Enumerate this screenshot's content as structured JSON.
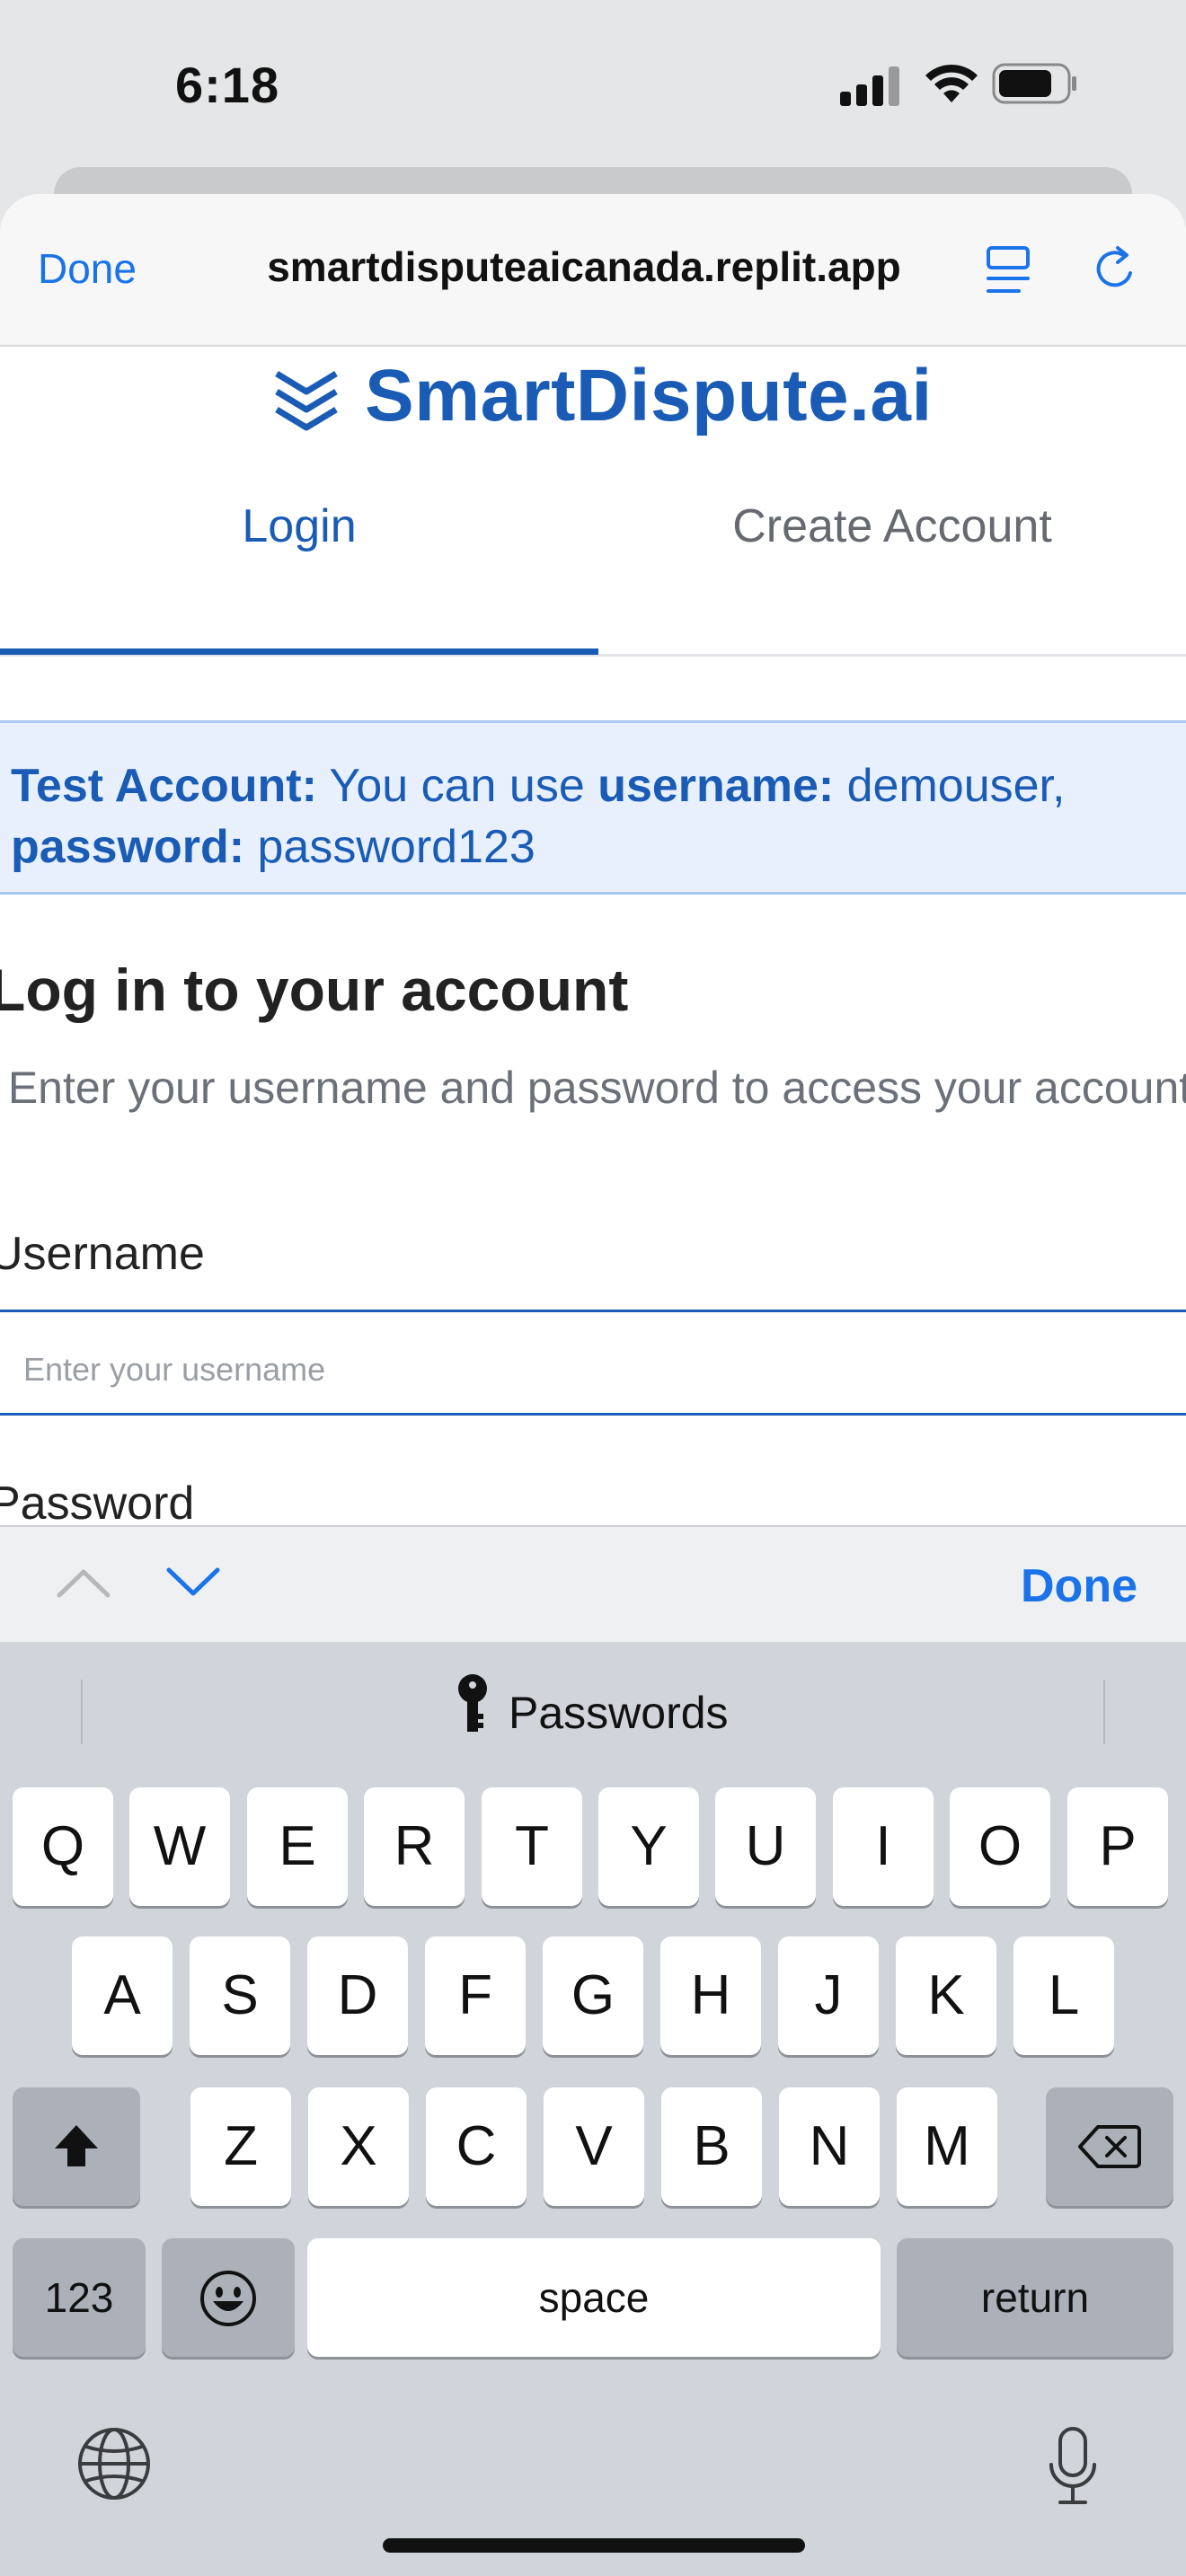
{
  "status_bar": {
    "time": "6:18"
  },
  "browser": {
    "done_label": "Done",
    "url": "smartdisputeaicanada.replit.app",
    "icons": [
      "reader-icon",
      "reload-icon"
    ]
  },
  "brand": {
    "name": "SmartDispute.ai",
    "accent_color": "#1a5cb5"
  },
  "tabs": [
    {
      "label": "Login",
      "active": true
    },
    {
      "label": "Create Account",
      "active": false
    }
  ],
  "test_account": {
    "prefix": "Test Account:",
    "text1": " You can use ",
    "username_key": "username:",
    "username_value": " demouser,",
    "password_key": "password:",
    "password_value": " password123"
  },
  "login": {
    "heading": "Log in to your account",
    "subtext": "Enter your username and password to access your account",
    "username_label": "Username",
    "username_placeholder": "Enter your username",
    "password_label": "Password"
  },
  "accessory": {
    "done_label": "Done"
  },
  "keyboard": {
    "quicktype": "Passwords",
    "row1": [
      "Q",
      "W",
      "E",
      "R",
      "T",
      "Y",
      "U",
      "I",
      "O",
      "P"
    ],
    "row2": [
      "A",
      "S",
      "D",
      "F",
      "G",
      "H",
      "J",
      "K",
      "L"
    ],
    "row3": [
      "Z",
      "X",
      "C",
      "V",
      "B",
      "N",
      "M"
    ],
    "numbers_label": "123",
    "space_label": "space",
    "return_label": "return"
  }
}
